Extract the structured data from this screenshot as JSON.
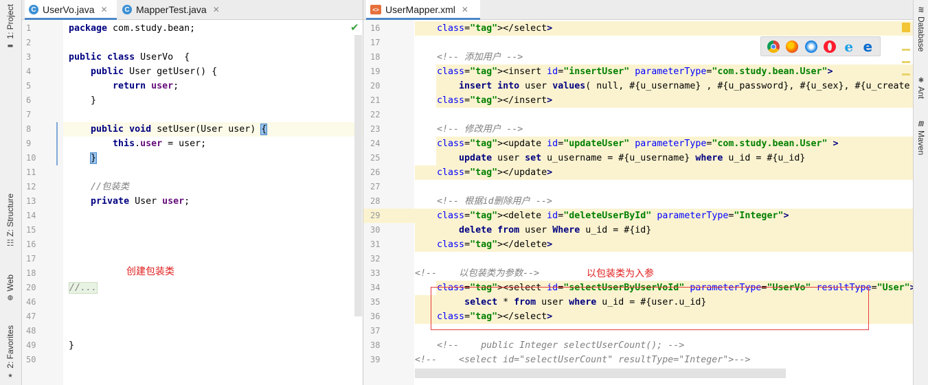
{
  "tool_windows_left": [
    {
      "label": "1: Project",
      "icon": "folder-icon"
    },
    {
      "label": "Z: Structure",
      "icon": "structure-icon"
    },
    {
      "label": "Web",
      "icon": "globe-icon"
    },
    {
      "label": "2: Favorites",
      "icon": "star-icon"
    }
  ],
  "tool_windows_right": [
    {
      "label": "Database",
      "icon": "database-icon"
    },
    {
      "label": "Ant",
      "icon": "ant-icon"
    },
    {
      "label": "Maven",
      "icon": "maven-icon"
    }
  ],
  "left_tabs": [
    {
      "label": "UserVo.java",
      "icon": "java-class-icon",
      "active": true
    },
    {
      "label": "MapperTest.java",
      "icon": "java-class-icon",
      "active": false
    }
  ],
  "right_tabs": [
    {
      "label": "UserMapper.xml",
      "icon": "xml-file-icon",
      "active": true
    }
  ],
  "left_editor": {
    "lines": [
      {
        "n": "1",
        "text": "package com.study.bean;"
      },
      {
        "n": "2",
        "text": ""
      },
      {
        "n": "3",
        "text": "public class UserVo  {"
      },
      {
        "n": "4",
        "text": "    public User getUser() {"
      },
      {
        "n": "5",
        "text": "        return user;"
      },
      {
        "n": "6",
        "text": "    }"
      },
      {
        "n": "7",
        "text": ""
      },
      {
        "n": "8",
        "text": "    public void setUser(User user) {"
      },
      {
        "n": "9",
        "text": "        this.user = user;"
      },
      {
        "n": "10",
        "text": "    }"
      },
      {
        "n": "11",
        "text": ""
      },
      {
        "n": "12",
        "text": "    //包装类"
      },
      {
        "n": "13",
        "text": "    private User user;"
      },
      {
        "n": "14",
        "text": ""
      },
      {
        "n": "15",
        "text": ""
      },
      {
        "n": "16",
        "text": ""
      },
      {
        "n": "17",
        "text": ""
      },
      {
        "n": "18",
        "text": ""
      },
      {
        "n": "20",
        "text": "//..."
      },
      {
        "n": "46",
        "text": ""
      },
      {
        "n": "47",
        "text": ""
      },
      {
        "n": "48",
        "text": ""
      },
      {
        "n": "49",
        "text": "}"
      },
      {
        "n": "50",
        "text": ""
      }
    ],
    "annotation": "创建包装类"
  },
  "right_editor": {
    "lines": [
      {
        "n": "16",
        "text": "    </select>"
      },
      {
        "n": "17",
        "text": ""
      },
      {
        "n": "18",
        "text": "    <!-- 添加用户 -->"
      },
      {
        "n": "19",
        "text": "    <insert id=\"insertUser\" parameterType=\"com.study.bean.User\">"
      },
      {
        "n": "20",
        "text": "        insert into user values( null, #{u_username} , #{u_password}, #{u_sex}, #{u_create"
      },
      {
        "n": "21",
        "text": "    </insert>"
      },
      {
        "n": "22",
        "text": ""
      },
      {
        "n": "23",
        "text": "    <!-- 修改用户 -->"
      },
      {
        "n": "24",
        "text": "    <update id=\"updateUser\" parameterType=\"com.study.bean.User\" >"
      },
      {
        "n": "25",
        "text": "        update user set u_username = #{u_username} where u_id = #{u_id}"
      },
      {
        "n": "26",
        "text": "    </update>"
      },
      {
        "n": "27",
        "text": ""
      },
      {
        "n": "28",
        "text": "    <!-- 根据id删除用户 -->"
      },
      {
        "n": "29",
        "text": "    <delete id=\"deleteUserById\" parameterType=\"Integer\">"
      },
      {
        "n": "30",
        "text": "        delete from user Where u_id = #{id}"
      },
      {
        "n": "31",
        "text": "    </delete>"
      },
      {
        "n": "32",
        "text": ""
      },
      {
        "n": "33",
        "text": "<!--    以包装类为参数-->"
      },
      {
        "n": "34",
        "text": "    <select id=\"selectUserByUserVoId\" parameterType=\"UserVo\" resultType=\"User\">"
      },
      {
        "n": "35",
        "text": "         select * from user where u_id = #{user.u_id}"
      },
      {
        "n": "36",
        "text": "    </select>"
      },
      {
        "n": "37",
        "text": ""
      },
      {
        "n": "38",
        "text": "    <!--    public Integer selectUserCount(); -->"
      },
      {
        "n": "39",
        "text": "<!--    <select id=\"selectUserCount\" resultType=\"Integer\">-->"
      }
    ],
    "annotation": "以包装类为入参"
  },
  "browser_icons": [
    "chrome-icon",
    "firefox-icon",
    "safari-icon",
    "opera-icon",
    "ie-icon",
    "edge-icon"
  ],
  "colors": {
    "keyword": "#000080",
    "field": "#660e7a",
    "comment": "#808080",
    "attr_name": "#0000ff",
    "attr_value": "#008000",
    "annotation": "#e02020",
    "band": "#fbf3d0",
    "tab_accent": "#4a88c7"
  }
}
